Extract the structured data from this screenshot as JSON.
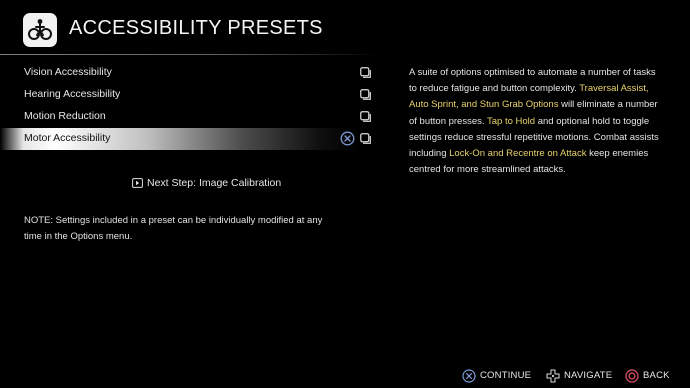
{
  "header": {
    "title": "ACCESSIBILITY PRESETS",
    "icon": "accessibility-presets-icon"
  },
  "options": [
    {
      "label": "Vision Accessibility",
      "selected": false
    },
    {
      "label": "Hearing Accessibility",
      "selected": false
    },
    {
      "label": "Motion Reduction",
      "selected": false
    },
    {
      "label": "Motor Accessibility",
      "selected": true
    }
  ],
  "next_step": {
    "label": "Next Step: Image Calibration",
    "icon": "next-step-icon"
  },
  "note": "NOTE: Settings included in a preset can be individually modified at any time in the Options menu.",
  "description": {
    "t1": "A suite of options optimised to automate a number of tasks to reduce fatigue and button complexity. ",
    "h1": "Traversal Assist, Auto Sprint, and Stun Grab Options",
    "t2": " will eliminate a number of button presses. ",
    "h2": "Tap to Hold",
    "t3": " and optional hold to toggle settings reduce stressful repetitive motions. Combat assists including ",
    "h3": "Lock-On and Recentre on Attack",
    "t4": " keep enemies centred for more streamlined attacks."
  },
  "footer": {
    "continue_label": "CONTINUE",
    "navigate_label": "NAVIGATE",
    "back_label": "BACK"
  },
  "colors": {
    "background": "#000000",
    "highlight_text": "#e8d36c",
    "cross_button": "#7f9bd6",
    "circle_button": "#e8556a"
  }
}
